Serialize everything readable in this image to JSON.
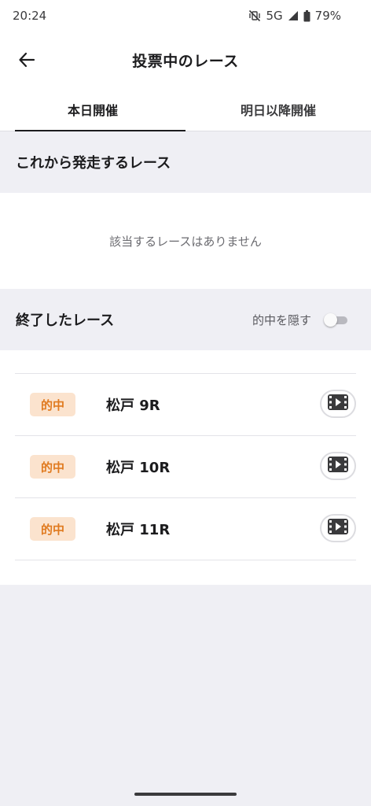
{
  "status_bar": {
    "time": "20:24",
    "network": "5G",
    "battery": "79%",
    "icons": [
      "vibrate-off-icon",
      "signal-icon",
      "battery-icon"
    ]
  },
  "header": {
    "title": "投票中のレース",
    "back_icon": "arrow-left-icon"
  },
  "tabs": [
    {
      "label": "本日開催",
      "active": true
    },
    {
      "label": "明日以降開催",
      "active": false
    }
  ],
  "upcoming": {
    "title": "これから発走するレース",
    "empty_message": "該当するレースはありません"
  },
  "finished": {
    "title": "終了したレース",
    "toggle_label": "的中を隠す",
    "toggle_on": false,
    "races": [
      {
        "badge": "的中",
        "name": "松戸 9R",
        "action_icon": "video-play-icon"
      },
      {
        "badge": "的中",
        "name": "松戸 10R",
        "action_icon": "video-play-icon"
      },
      {
        "badge": "的中",
        "name": "松戸 11R",
        "action_icon": "video-play-icon"
      }
    ]
  },
  "colors": {
    "background": "#efeff4",
    "badge_bg": "#fbe3ce",
    "badge_text": "#e07a1f",
    "text_primary": "#1c1c1e"
  }
}
